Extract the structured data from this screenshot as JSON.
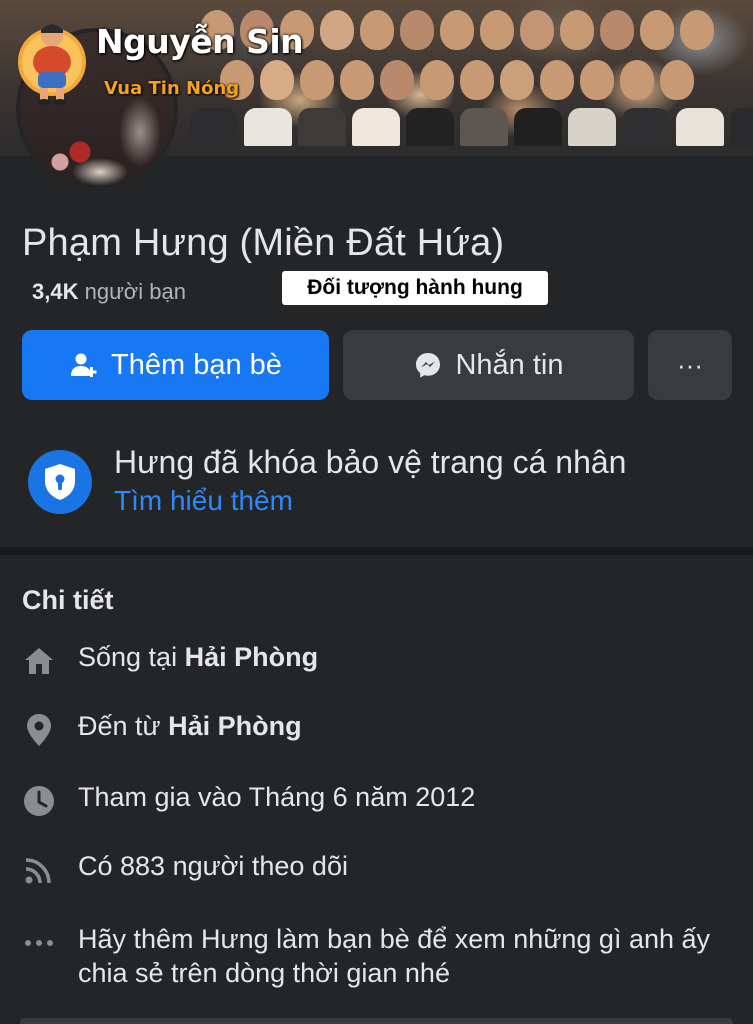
{
  "watermark": {
    "name": "Nguyễn Sin",
    "tagline": "Vua Tin Nóng"
  },
  "profile": {
    "name": "Phạm Hưng (Miền Đất Hứa)",
    "friends_count": "3,4K",
    "friends_label": "người bạn"
  },
  "annotation": {
    "text": "Đối tượng hành hung"
  },
  "actions": {
    "add_friend": "Thêm bạn bè",
    "message": "Nhắn tin",
    "more": "···"
  },
  "lock_notice": {
    "title": "Hưng đã khóa bảo vệ trang cá nhân",
    "link": "Tìm hiểu thêm"
  },
  "details": {
    "title": "Chi tiết",
    "lives_in_prefix": "Sống tại",
    "lives_in_value": "Hải Phòng",
    "from_prefix": "Đến từ",
    "from_value": "Hải Phòng",
    "joined": "Tham gia vào Tháng 6 năm 2012",
    "followers": "Có 883 người theo dõi",
    "add_hint": "Hãy thêm Hưng làm bạn bè để xem những gì anh ấy chia sẻ trên dòng thời gian nhé"
  },
  "colors": {
    "background": "#242526",
    "primary": "#1877f2",
    "link": "#2d88ff",
    "secondary_button": "#3a3b3c",
    "watermark_accent": "#f6a21b"
  },
  "icons": {
    "add_friend": "person-plus-icon",
    "message": "messenger-icon",
    "lock": "shield-lock-icon",
    "home": "home-icon",
    "location": "location-pin-icon",
    "clock": "clock-icon",
    "followers": "rss-icon",
    "more": "ellipsis-icon"
  }
}
